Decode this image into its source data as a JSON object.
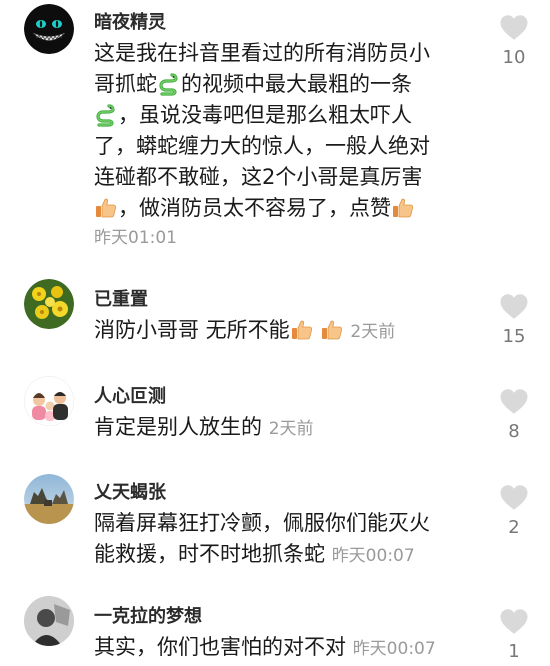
{
  "comments": [
    {
      "username": "暗夜精灵",
      "lines": [
        "这是我在抖音里看过的所有消防员小",
        "哥抓蛇",
        "的视频中最大最粗的一条",
        "，虽说没毒吧但是那么粗太吓人",
        "了，蟒蛇缠力大的惊人，一般人绝对",
        "连碰都不敢碰，这2个小哥是真厉害",
        "，做消防员太不容易了，点赞"
      ],
      "time": "昨天01:01",
      "likes": "10"
    },
    {
      "username": "已重置",
      "text": "消防小哥哥 无所不能",
      "time": "2天前",
      "likes": "15"
    },
    {
      "username": "人心叵测",
      "text": "肯定是别人放生的",
      "time": "2天前",
      "likes": "8"
    },
    {
      "username": "乂天蝎张",
      "lines": [
        "隔着屏幕狂打冷颤，佩服你们能灭火",
        "能救援，时不时地抓条蛇"
      ],
      "time": "昨天00:07",
      "likes": "2"
    },
    {
      "username": "一克拉的梦想",
      "text": "其实，你们也害怕的对不对",
      "time": "昨天00:07",
      "likes": "1"
    }
  ],
  "icons": {
    "like": "heart-icon",
    "snake": "snake-emoji-icon",
    "thumbs_up": "thumbs-up-emoji-icon"
  },
  "colors": {
    "heart": "#d9d9d9",
    "time": "#9a9a9a",
    "username": "#2b2b2b"
  }
}
